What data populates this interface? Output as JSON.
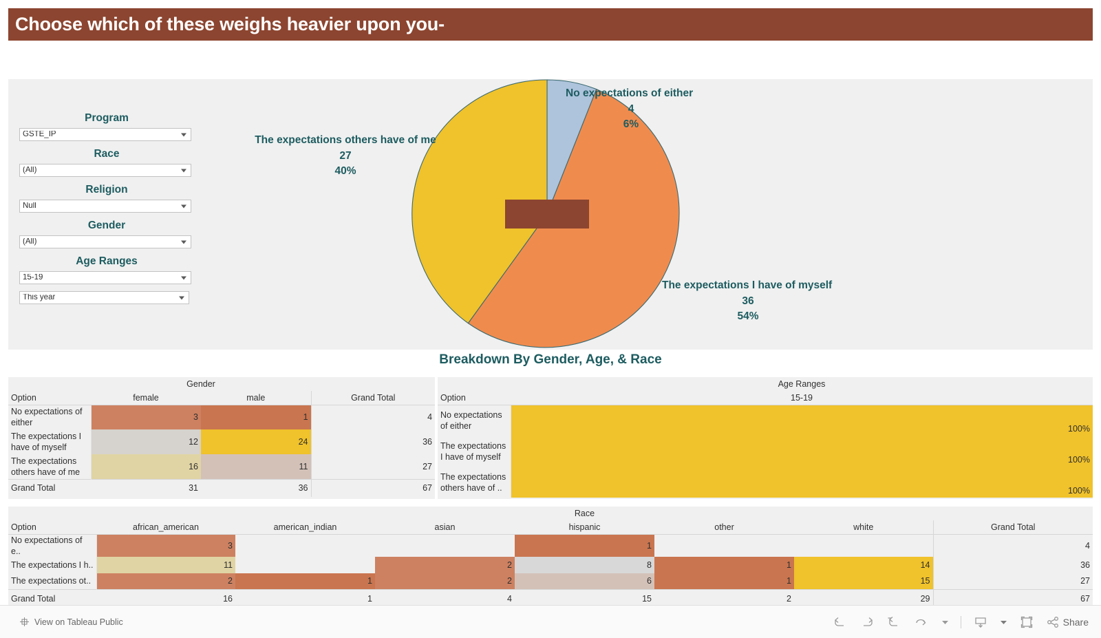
{
  "header": {
    "title": "Choose which of these weighs heavier upon you-",
    "bg_color": "#8c4530",
    "text_color": "#ffffff"
  },
  "filters": [
    {
      "label": "Program",
      "value": "GSTE_IP",
      "name": "program"
    },
    {
      "label": "Race",
      "value": "(All)",
      "name": "race"
    },
    {
      "label": "Religion",
      "value": "Null",
      "name": "religion"
    },
    {
      "label": "Gender",
      "value": "(All)",
      "name": "gender"
    },
    {
      "label": "Age Ranges",
      "value": "15-19",
      "name": "age-ranges"
    }
  ],
  "date_filter": {
    "value": "This year"
  },
  "chart_data": {
    "type": "pie",
    "title": "Choose which of these weighs heavier upon you-",
    "categories": [
      "No expectations of either",
      "The expectations I have of myself",
      "The expectations others have of me"
    ],
    "values": [
      4,
      36,
      27
    ],
    "percents": [
      "6%",
      "54%",
      "40%"
    ],
    "colors": [
      "#aec3dc",
      "#f08b4e",
      "#f0c22b"
    ],
    "total": 67,
    "legend": "labels-on-slices",
    "labels": [
      {
        "name": "No expectations of either",
        "value": "4",
        "percent": "6%"
      },
      {
        "name": "The expectations I have of myself",
        "value": "36",
        "percent": "54%"
      },
      {
        "name": "The expectations others have of me",
        "value": "27",
        "percent": "40%"
      }
    ]
  },
  "breakdown": {
    "title": "Breakdown By Gender, Age, & Race"
  },
  "gender_table": {
    "group_header": "Gender",
    "option_header": "Option",
    "columns": [
      "female",
      "male"
    ],
    "grand_total_header": "Grand Total",
    "rows": [
      {
        "option": "No expectations of either",
        "cells": [
          "3",
          "1"
        ],
        "colors": [
          "#cd8161",
          "#c9754f"
        ],
        "total": "4"
      },
      {
        "option": "The expectations I have of myself",
        "cells": [
          "12",
          "24"
        ],
        "colors": [
          "#d6d2cd",
          "#f0c22b"
        ],
        "total": "36"
      },
      {
        "option": "The expectations others have of me",
        "cells": [
          "16",
          "11"
        ],
        "colors": [
          "#e0d4a4",
          "#d3c1b8"
        ],
        "total": "27"
      }
    ],
    "total_row": {
      "label": "Grand Total",
      "cells": [
        "31",
        "36"
      ],
      "total": "67"
    }
  },
  "age_table": {
    "group_header": "Age Ranges",
    "option_header": "Option",
    "columns": [
      "15-19"
    ],
    "rows": [
      {
        "option": "No expectations of either",
        "cells": [
          "100%"
        ],
        "colors": [
          "#f0c22b"
        ]
      },
      {
        "option": "The expectations I have of myself",
        "cells": [
          "100%"
        ],
        "colors": [
          "#f0c22b"
        ]
      },
      {
        "option": "The expectations others have of ..",
        "cells": [
          "100%"
        ],
        "colors": [
          "#f0c22b"
        ]
      }
    ]
  },
  "race_table": {
    "group_header": "Race",
    "option_header": "Option",
    "columns": [
      "african_american",
      "american_indian",
      "asian",
      "hispanic",
      "other",
      "white"
    ],
    "grand_total_header": "Grand Total",
    "rows": [
      {
        "option": "No expectations of e..",
        "cells": [
          "3",
          "",
          "",
          "1",
          "",
          ""
        ],
        "colors": [
          "#cd8161",
          "",
          "",
          "#c9754f",
          "",
          ""
        ],
        "total": "4"
      },
      {
        "option": "The expectations I h..",
        "cells": [
          "11",
          "",
          "2",
          "8",
          "1",
          "14"
        ],
        "colors": [
          "#e0d4a4",
          "",
          "#cd8161",
          "#d8d8d8",
          "#c9754f",
          "#f0c22b"
        ],
        "total": "36"
      },
      {
        "option": "The expectations ot..",
        "cells": [
          "2",
          "1",
          "2",
          "6",
          "1",
          "15"
        ],
        "colors": [
          "#cd8161",
          "#c9754f",
          "#cd8161",
          "#d3c1b8",
          "#c9754f",
          "#f0c22b"
        ],
        "total": "27"
      }
    ],
    "total_row": {
      "label": "Grand Total",
      "cells": [
        "16",
        "1",
        "4",
        "15",
        "2",
        "29"
      ],
      "total": "67"
    }
  },
  "toolbar": {
    "view_label": "View on Tableau Public",
    "share_label": "Share",
    "icons": [
      "tableau-logo-icon",
      "undo-icon",
      "redo-icon",
      "revert-icon",
      "refresh-icon",
      "refresh-dropdown-icon",
      "download-icon",
      "download-dropdown-icon",
      "fullscreen-icon",
      "share-icon"
    ]
  }
}
